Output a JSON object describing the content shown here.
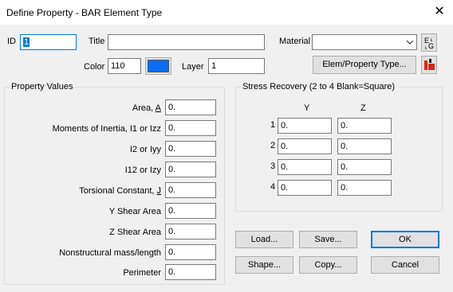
{
  "window": {
    "title": "Define Property - BAR Element Type",
    "close_glyph": "✕"
  },
  "header": {
    "id_label": "ID",
    "id_value": "1",
    "title_label": "Title",
    "title_value": "",
    "material_label": "Material",
    "material_value": "",
    "color_label": "Color",
    "color_value": "110",
    "color_swatch": "#0a6ef5",
    "layer_label": "Layer",
    "layer_value": "1",
    "elem_property_type_button": "Elem/Property Type..."
  },
  "property_values": {
    "group_title": "Property Values",
    "rows": [
      {
        "label": "Area,",
        "hot": "A",
        "value": "0."
      },
      {
        "label": "Moments of Inertia,  I1 or Izz",
        "value": "0."
      },
      {
        "label": "I2 or Iyy",
        "value": "0."
      },
      {
        "label": "I12 or Izy",
        "value": "0."
      },
      {
        "label": "Torsional Constant,",
        "hot": "J",
        "value": "0."
      },
      {
        "label": "Y Shear Area",
        "value": "0."
      },
      {
        "label": "Z Shear Area",
        "value": "0."
      },
      {
        "label": "Nonstructural mass/length",
        "value": "0."
      },
      {
        "label": "Perimeter",
        "value": "0."
      }
    ]
  },
  "stress_recovery": {
    "group_title": "Stress Recovery (2 to 4 Blank=Square)",
    "col_y": "Y",
    "col_z": "Z",
    "rows": [
      {
        "num": "1",
        "y": "0.",
        "z": "0."
      },
      {
        "num": "2",
        "y": "0.",
        "z": "0."
      },
      {
        "num": "3",
        "y": "0.",
        "z": "0."
      },
      {
        "num": "4",
        "y": "0.",
        "z": "0."
      }
    ]
  },
  "buttons": {
    "load": "Load...",
    "save": "Save...",
    "ok": "OK",
    "shape": "Shape...",
    "copy": "Copy...",
    "cancel": "Cancel"
  }
}
